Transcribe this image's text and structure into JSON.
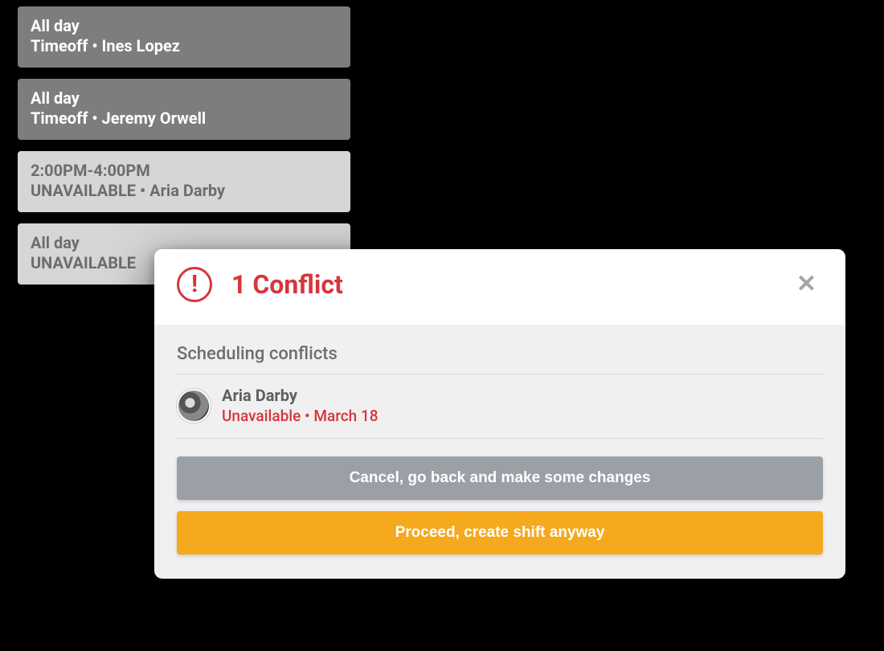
{
  "events": [
    {
      "time": "All day",
      "detail": "Timeoff • Ines Lopez",
      "tone": "dark"
    },
    {
      "time": "All day",
      "detail": "Timeoff • Jeremy Orwell",
      "tone": "dark"
    },
    {
      "time": "2:00PM-4:00PM",
      "detail": "UNAVAILABLE • Aria Darby",
      "tone": "light"
    },
    {
      "time": "All day",
      "detail": "UNAVAILABLE",
      "tone": "light"
    }
  ],
  "modal": {
    "title": "1 Conflict",
    "section_heading": "Scheduling conflicts",
    "conflict": {
      "name": "Aria Darby",
      "reason": "Unavailable • March 18"
    },
    "cancel_label": "Cancel, go back and make some changes",
    "proceed_label": "Proceed, create shift anyway",
    "close_glyph": "✕",
    "alert_glyph": "!"
  }
}
